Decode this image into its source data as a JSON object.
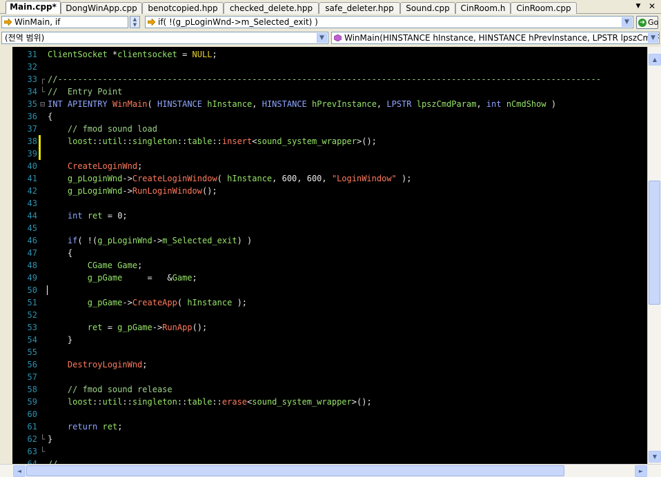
{
  "tabs": [
    {
      "label": "Main.cpp*",
      "active": true
    },
    {
      "label": "DongWinApp.cpp",
      "active": false
    },
    {
      "label": "benotcopied.hpp",
      "active": false
    },
    {
      "label": "checked_delete.hpp",
      "active": false
    },
    {
      "label": "safe_deleter.hpp",
      "active": false
    },
    {
      "label": "Sound.cpp",
      "active": false
    },
    {
      "label": "CinRoom.h",
      "active": false
    },
    {
      "label": "CinRoom.cpp",
      "active": false
    }
  ],
  "window_buttons": {
    "pin": "▼",
    "close": "✕"
  },
  "navigation": {
    "bookmark_combo": "WinMain, if",
    "statement_combo": "if( !(g_pLoginWnd->m_Selected_exit) )",
    "go_label": "Go"
  },
  "scope": {
    "scope_combo": "(전역 범위)",
    "function_combo": "WinMain(HINSTANCE hInstance, HINSTANCE hPrevInstance, LPSTR lpszCmdParam, int nCmdShow)"
  },
  "colors": {
    "keyword": "#8fa6ff",
    "identifier": "#98e36a",
    "function": "#ff7a5c",
    "comment": "#9fd28a",
    "line_number": "#2b91af",
    "background": "#000000",
    "change_marker": "#e8e800"
  },
  "code_lines": [
    {
      "num": "31",
      "tokens": [
        [
          "ClientSocket ",
          "id"
        ],
        [
          "*",
          "def"
        ],
        [
          "clientsocket",
          "id"
        ],
        [
          " = ",
          "def"
        ],
        [
          "NULL",
          "mac"
        ],
        [
          ";",
          "def"
        ]
      ]
    },
    {
      "num": "32",
      "tokens": []
    },
    {
      "num": "33",
      "tokens": [
        [
          "//-------------------------------------------------------------------------------------------------------------",
          "cm"
        ]
      ],
      "fold": "┌"
    },
    {
      "num": "34",
      "tokens": [
        [
          "//  Entry Point",
          "cm"
        ]
      ],
      "fold": "└"
    },
    {
      "num": "35",
      "tokens": [
        [
          "INT",
          "kw"
        ],
        [
          " ",
          "def"
        ],
        [
          "APIENTRY",
          "kw"
        ],
        [
          " ",
          "def"
        ],
        [
          "WinMain",
          "fn"
        ],
        [
          "( ",
          "def"
        ],
        [
          "HINSTANCE",
          "kw"
        ],
        [
          " ",
          "def"
        ],
        [
          "hInstance",
          "id"
        ],
        [
          ", ",
          "def"
        ],
        [
          "HINSTANCE",
          "kw"
        ],
        [
          " ",
          "def"
        ],
        [
          "hPrevInstance",
          "id"
        ],
        [
          ", ",
          "def"
        ],
        [
          "LPSTR",
          "kw"
        ],
        [
          " ",
          "def"
        ],
        [
          "lpszCmdParam",
          "id"
        ],
        [
          ", ",
          "def"
        ],
        [
          "int",
          "kw"
        ],
        [
          " ",
          "def"
        ],
        [
          "nCmdShow",
          "id"
        ],
        [
          " )",
          "def"
        ]
      ],
      "fold": "⊟"
    },
    {
      "num": "36",
      "tokens": [
        [
          "{",
          "def"
        ]
      ]
    },
    {
      "num": "37",
      "tokens": [
        [
          "    // fmod sound load",
          "cm"
        ]
      ]
    },
    {
      "num": "38",
      "tokens": [
        [
          "    ",
          "def"
        ],
        [
          "loost",
          "id"
        ],
        [
          "::",
          "def"
        ],
        [
          "util",
          "id"
        ],
        [
          "::",
          "def"
        ],
        [
          "singleton",
          "id"
        ],
        [
          "::",
          "def"
        ],
        [
          "table",
          "id"
        ],
        [
          "::",
          "def"
        ],
        [
          "insert",
          "fn"
        ],
        [
          "<",
          "def"
        ],
        [
          "sound_system_wrapper",
          "id"
        ],
        [
          ">();",
          "def"
        ]
      ],
      "mark": true
    },
    {
      "num": "39",
      "tokens": [],
      "mark": true
    },
    {
      "num": "40",
      "tokens": [
        [
          "    ",
          "def"
        ],
        [
          "CreateLoginWnd",
          "fn"
        ],
        [
          ";",
          "def"
        ]
      ]
    },
    {
      "num": "41",
      "tokens": [
        [
          "    ",
          "def"
        ],
        [
          "g_pLoginWnd",
          "id"
        ],
        [
          "->",
          "def"
        ],
        [
          "CreateLoginWindow",
          "fn"
        ],
        [
          "( ",
          "def"
        ],
        [
          "hInstance",
          "id"
        ],
        [
          ", 600, 600, ",
          "def"
        ],
        [
          "\"LoginWindow\"",
          "str"
        ],
        [
          " );",
          "def"
        ]
      ]
    },
    {
      "num": "42",
      "tokens": [
        [
          "    ",
          "def"
        ],
        [
          "g_pLoginWnd",
          "id"
        ],
        [
          "->",
          "def"
        ],
        [
          "RunLoginWindow",
          "fn"
        ],
        [
          "();",
          "def"
        ]
      ]
    },
    {
      "num": "43",
      "tokens": []
    },
    {
      "num": "44",
      "tokens": [
        [
          "    ",
          "def"
        ],
        [
          "int",
          "kw"
        ],
        [
          " ",
          "def"
        ],
        [
          "ret",
          "id"
        ],
        [
          " = 0;",
          "def"
        ]
      ]
    },
    {
      "num": "45",
      "tokens": []
    },
    {
      "num": "46",
      "tokens": [
        [
          "    ",
          "def"
        ],
        [
          "if",
          "kw"
        ],
        [
          "( !(",
          "def"
        ],
        [
          "g_pLoginWnd",
          "id"
        ],
        [
          "->",
          "def"
        ],
        [
          "m_Selected_exit",
          "id"
        ],
        [
          ") )",
          "def"
        ]
      ]
    },
    {
      "num": "47",
      "tokens": [
        [
          "    {",
          "def"
        ]
      ]
    },
    {
      "num": "48",
      "tokens": [
        [
          "        ",
          "def"
        ],
        [
          "CGame",
          "id"
        ],
        [
          " ",
          "def"
        ],
        [
          "Game",
          "id"
        ],
        [
          ";",
          "def"
        ]
      ]
    },
    {
      "num": "49",
      "tokens": [
        [
          "        ",
          "def"
        ],
        [
          "g_pGame",
          "id"
        ],
        [
          "     =   &",
          "def"
        ],
        [
          "Game",
          "id"
        ],
        [
          ";",
          "def"
        ]
      ]
    },
    {
      "num": "50",
      "tokens": [],
      "cursor": true
    },
    {
      "num": "51",
      "tokens": [
        [
          "        ",
          "def"
        ],
        [
          "g_pGame",
          "id"
        ],
        [
          "->",
          "def"
        ],
        [
          "CreateApp",
          "fn"
        ],
        [
          "( ",
          "def"
        ],
        [
          "hInstance",
          "id"
        ],
        [
          " );",
          "def"
        ]
      ]
    },
    {
      "num": "52",
      "tokens": []
    },
    {
      "num": "53",
      "tokens": [
        [
          "        ",
          "def"
        ],
        [
          "ret",
          "id"
        ],
        [
          " = ",
          "def"
        ],
        [
          "g_pGame",
          "id"
        ],
        [
          "->",
          "def"
        ],
        [
          "RunApp",
          "fn"
        ],
        [
          "();",
          "def"
        ]
      ]
    },
    {
      "num": "54",
      "tokens": [
        [
          "    }",
          "def"
        ]
      ]
    },
    {
      "num": "55",
      "tokens": []
    },
    {
      "num": "56",
      "tokens": [
        [
          "    ",
          "def"
        ],
        [
          "DestroyLoginWnd",
          "fn"
        ],
        [
          ";",
          "def"
        ]
      ]
    },
    {
      "num": "57",
      "tokens": []
    },
    {
      "num": "58",
      "tokens": [
        [
          "    // fmod sound release",
          "cm"
        ]
      ]
    },
    {
      "num": "59",
      "tokens": [
        [
          "    ",
          "def"
        ],
        [
          "loost",
          "id"
        ],
        [
          "::",
          "def"
        ],
        [
          "util",
          "id"
        ],
        [
          "::",
          "def"
        ],
        [
          "singleton",
          "id"
        ],
        [
          "::",
          "def"
        ],
        [
          "table",
          "id"
        ],
        [
          "::",
          "def"
        ],
        [
          "erase",
          "fn"
        ],
        [
          "<",
          "def"
        ],
        [
          "sound_system_wrapper",
          "id"
        ],
        [
          ">();",
          "def"
        ]
      ]
    },
    {
      "num": "60",
      "tokens": []
    },
    {
      "num": "61",
      "tokens": [
        [
          "    ",
          "def"
        ],
        [
          "return",
          "kw"
        ],
        [
          " ",
          "def"
        ],
        [
          "ret",
          "id"
        ],
        [
          ";",
          "def"
        ]
      ]
    },
    {
      "num": "62",
      "tokens": [
        [
          "}",
          "def"
        ]
      ],
      "fold": "└"
    },
    {
      "num": "63",
      "tokens": [],
      "fold": "└"
    },
    {
      "num": "64",
      "tokens": [
        [
          "//",
          "cm"
        ]
      ]
    }
  ],
  "scrollbar": {
    "up": "▲",
    "down": "▼",
    "left": "◄",
    "right": "►"
  }
}
